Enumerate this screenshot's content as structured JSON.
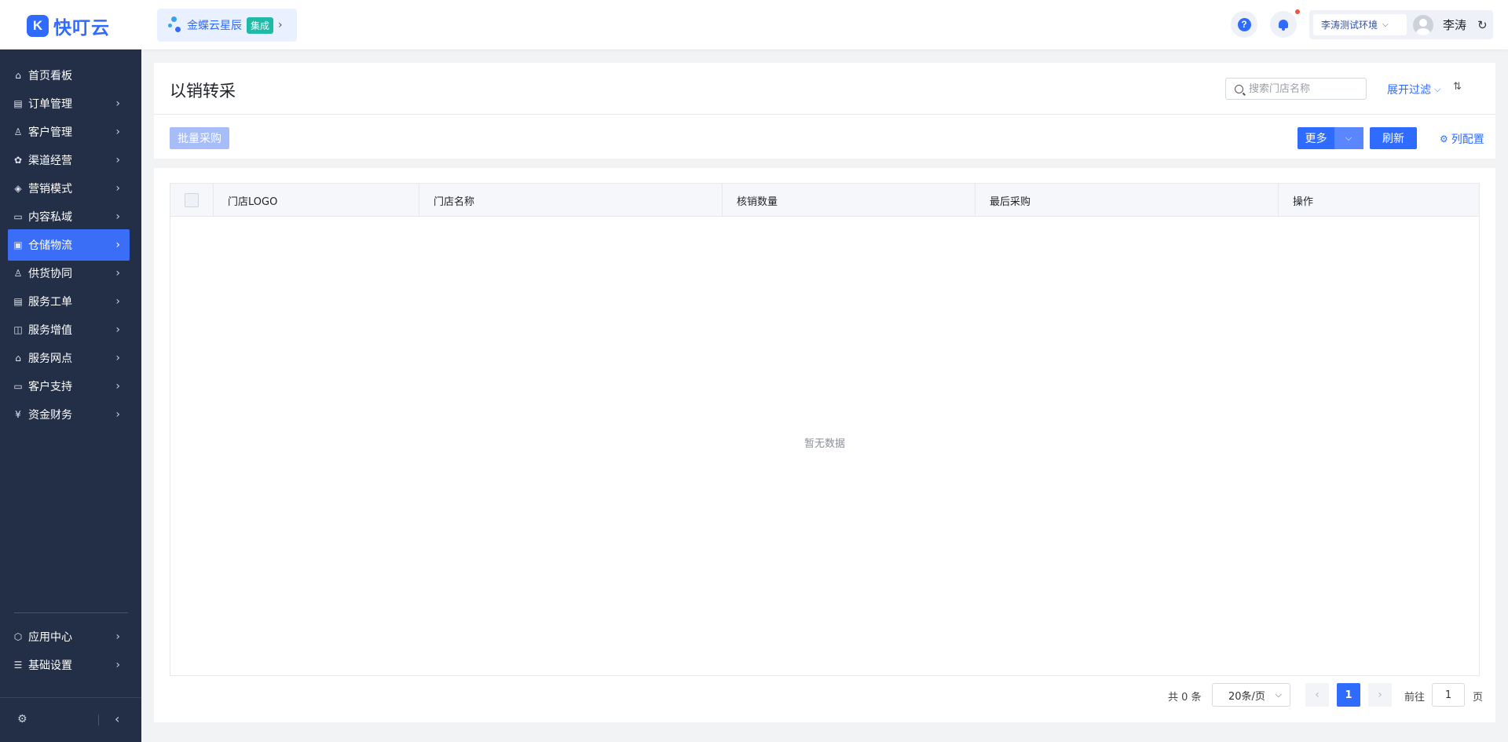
{
  "header": {
    "logo_mark": "K",
    "logo_text": "快叮云",
    "integration": {
      "label": "金蝶云星辰",
      "badge": "集成"
    },
    "help_icon": "question-mark-icon",
    "bell_icon": "bell-icon",
    "env_select": "李涛测试环境",
    "user_name": "李涛"
  },
  "sidebar": {
    "items": [
      {
        "label": "首页看板",
        "icon": "home-icon",
        "glyph": "⌂",
        "has_children": false
      },
      {
        "label": "订单管理",
        "icon": "clipboard-icon",
        "glyph": "▤",
        "has_children": true
      },
      {
        "label": "客户管理",
        "icon": "user-icon",
        "glyph": "♙",
        "has_children": true
      },
      {
        "label": "渠道经营",
        "icon": "channel-icon",
        "glyph": "✿",
        "has_children": true
      },
      {
        "label": "营销模式",
        "icon": "tag-icon",
        "glyph": "◈",
        "has_children": true
      },
      {
        "label": "内容私域",
        "icon": "image-icon",
        "glyph": "▭",
        "has_children": true
      },
      {
        "label": "仓储物流",
        "icon": "warehouse-icon",
        "glyph": "▣",
        "has_children": true,
        "active": true
      },
      {
        "label": "供货协同",
        "icon": "supplier-icon",
        "glyph": "♙",
        "has_children": true
      },
      {
        "label": "服务工单",
        "icon": "ticket-icon",
        "glyph": "▤",
        "has_children": true
      },
      {
        "label": "服务增值",
        "icon": "bag-icon",
        "glyph": "◫",
        "has_children": true
      },
      {
        "label": "服务网点",
        "icon": "store-icon",
        "glyph": "⌂",
        "has_children": true
      },
      {
        "label": "客户支持",
        "icon": "support-icon",
        "glyph": "▭",
        "has_children": true
      },
      {
        "label": "资金财务",
        "icon": "yuan-icon",
        "glyph": "¥",
        "has_children": true
      }
    ],
    "bottom_items": [
      {
        "label": "应用中心",
        "icon": "cube-icon",
        "glyph": "⬡"
      },
      {
        "label": "基础设置",
        "icon": "settings-list-icon",
        "glyph": "☰"
      }
    ],
    "footer_gear": "gear-icon",
    "collapse": "chevron-left-icon"
  },
  "page": {
    "title": "以销转采",
    "search_placeholder": "搜索门店名称",
    "expand_filter": "展开过滤",
    "toolbar": {
      "batch_purchase": "批量采购",
      "more": "更多",
      "refresh": "刷新",
      "column_config": "列配置"
    }
  },
  "table": {
    "columns": [
      "门店LOGO",
      "门店名称",
      "核销数量",
      "最后采购",
      "操作"
    ],
    "rows": [],
    "empty_text": "暂无数据"
  },
  "pagination": {
    "total": "共 0 条",
    "page_size": "20条/页",
    "current_page": "1",
    "goto_label": "前往",
    "goto_value": "1",
    "goto_suffix": "页"
  },
  "colors": {
    "primary": "#2f6bff",
    "sidebar_bg": "#232f46",
    "sidebar_active": "#3b6ef6",
    "badge": "#1fb9a6",
    "notification_dot": "#f5533d"
  }
}
